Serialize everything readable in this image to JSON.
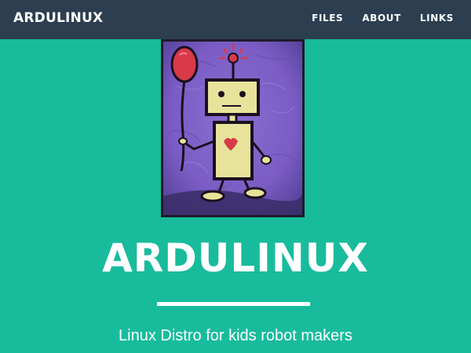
{
  "navbar": {
    "brand": "ARDULINUX",
    "links": [
      "FILES",
      "ABOUT",
      "LINKS"
    ]
  },
  "hero": {
    "image_icon": "robot-with-balloon-painting",
    "title": "ARDULINUX",
    "subtitle": "Linux Distro for kids robot makers"
  },
  "colors": {
    "navbar_bg": "#2c3e50",
    "hero_bg": "#18bc9c",
    "text": "#ffffff"
  }
}
